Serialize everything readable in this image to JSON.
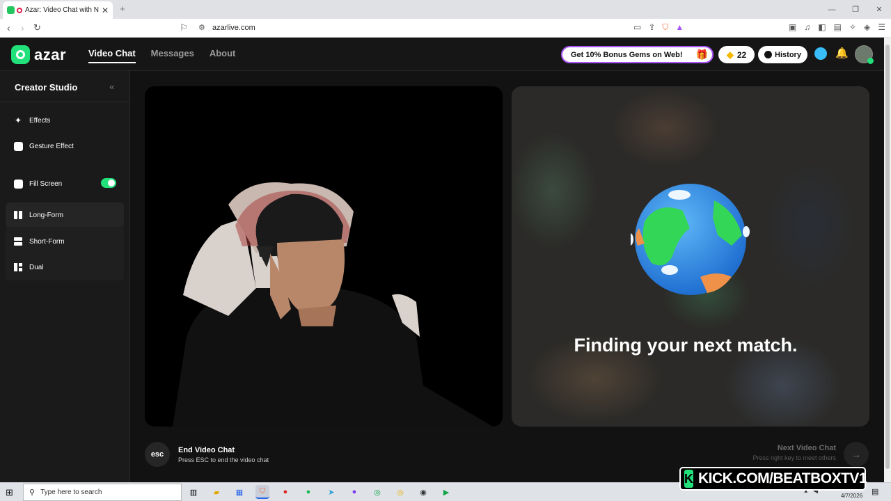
{
  "browser": {
    "tab_title": "Azar: Video Chat with New Fr",
    "url": "azarlive.com",
    "new_tab": "+",
    "close": "✕"
  },
  "header": {
    "logo_text": "azar",
    "nav": [
      {
        "label": "Video Chat",
        "active": true
      },
      {
        "label": "Messages",
        "active": false
      },
      {
        "label": "About",
        "active": false
      }
    ],
    "promo": "Get 10% Bonus Gems on Web!",
    "gems_count": "22",
    "history_label": "History"
  },
  "sidebar": {
    "title": "Creator Studio",
    "items": [
      {
        "label": "Effects",
        "icon": "magic-wand-icon"
      },
      {
        "label": "Gesture Effect",
        "icon": "smile-icon"
      },
      {
        "label": "Fill Screen",
        "icon": "expand-icon",
        "toggle_on": true
      }
    ],
    "layouts": [
      {
        "label": "Long-Form",
        "selected": true
      },
      {
        "label": "Short-Form",
        "selected": false
      },
      {
        "label": "Dual",
        "selected": false
      }
    ]
  },
  "main": {
    "status": "Finding your next match.",
    "end_key": "esc",
    "end_title": "End Video Chat",
    "end_sub": "Press ESC to end the video chat",
    "next_title": "Next Video Chat",
    "next_sub": "Press right key to meet others"
  },
  "taskbar": {
    "search_placeholder": "Type here to search",
    "date": "4/7/2026"
  },
  "overlay": {
    "kick_text": "KICK.COM/BEATBOXTV1",
    "kick_letter": "K"
  },
  "colors": {
    "accent": "#22e07a",
    "promo_border": "#a855f7",
    "background": "#121212"
  }
}
